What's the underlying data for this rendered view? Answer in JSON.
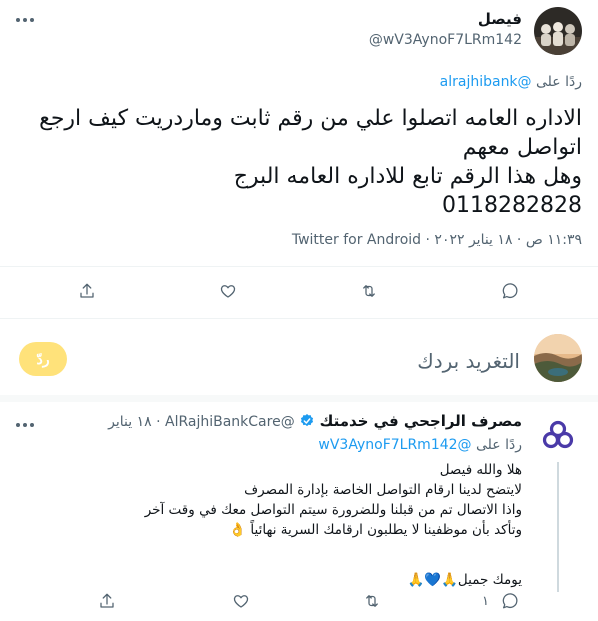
{
  "tweet": {
    "author_name": "فيصل",
    "author_handle": "@wV3AynoF7LRm142",
    "replying_prefix": "ردًا على",
    "replying_to": "@alrajhibank",
    "lines": [
      "الاداره العامه اتصلوا علي من رقم ثابت وماردريت كيف ارجع",
      "اتواصل معهم",
      "وهل هذا الرقم تابع للاداره العامه البرج",
      "0118282828"
    ],
    "meta": "١١:٣٩ ص · ١٨ يناير ٢٠٢٢ · Twitter for Android"
  },
  "composer": {
    "placeholder": "التغريد بردك",
    "reply_button": "ردّ"
  },
  "reply": {
    "author_name": "مصرف الراجحي في خدمتك",
    "author_handle": "@AlRajhiBankCare",
    "time": "١٨ يناير",
    "replying_prefix": "ردًا على",
    "replying_to": "@wV3AynoF7LRm142",
    "lines": [
      "هلا والله فيصل",
      "لايتضح لدينا ارقام التواصل الخاصة بإدارة المصرف",
      "واذا الاتصال تم من قبلنا وللضرورة سيتم التواصل معك في وقت آخر",
      "وتأكد بأن موظفينا لا يطلبون ارقامك السرية نهائياً 👌",
      "",
      "يومك جميل🙏💙🙏"
    ],
    "reply_count": "١"
  },
  "icons": {
    "more": "more-horizontal-icon",
    "reply": "reply-icon",
    "retweet": "retweet-icon",
    "like": "like-icon",
    "share": "share-icon",
    "verified": "verified-badge-icon"
  },
  "colors": {
    "accent": "#1d9bf0",
    "reply_button": "#ffe27a",
    "bank_logo": "#4a3aa8",
    "text": "#0f1419",
    "muted": "#536471"
  }
}
